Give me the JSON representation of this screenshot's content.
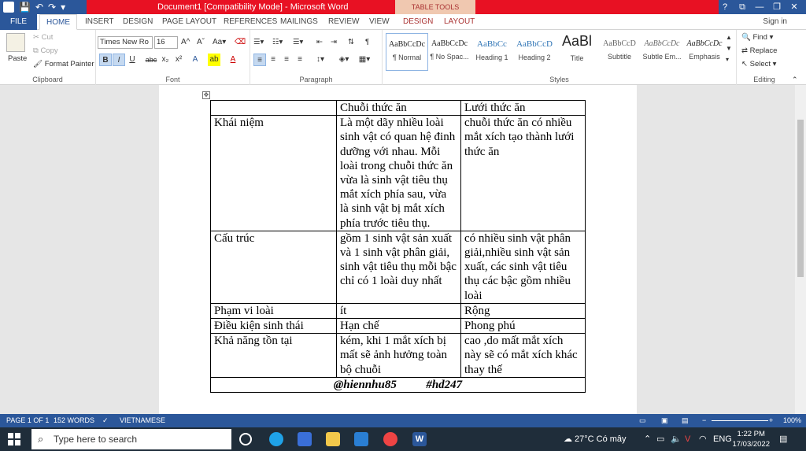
{
  "window": {
    "title": "Document1 [Compatibility Mode] -  Microsoft Word",
    "context_tab_group": "TABLE TOOLS",
    "help": "?",
    "restore_ribbon": "⧉",
    "minimize": "—",
    "maximize": "❐",
    "close": "✕"
  },
  "ribbon_tabs": [
    "FILE",
    "HOME",
    "INSERT",
    "DESIGN",
    "PAGE LAYOUT",
    "REFERENCES",
    "MAILINGS",
    "REVIEW",
    "VIEW",
    "DESIGN",
    "LAYOUT"
  ],
  "sign_in": "Sign in",
  "clipboard": {
    "paste": "Paste",
    "cut": "Cut",
    "copy": "Copy",
    "format_painter": "Format Painter",
    "label": "Clipboard"
  },
  "font": {
    "family": "Times New Ro",
    "size": "16",
    "label": "Font",
    "bold": "B",
    "italic": "I",
    "underline": "U",
    "strike": "abc",
    "subscript": "x₂",
    "superscript": "x²"
  },
  "paragraph": {
    "label": "Paragraph"
  },
  "styles": {
    "label": "Styles",
    "items": [
      {
        "sample": "AaBbCcDc",
        "name": "¶ Normal"
      },
      {
        "sample": "AaBbCcDc",
        "name": "¶ No Spac..."
      },
      {
        "sample": "AaBbCc",
        "name": "Heading 1"
      },
      {
        "sample": "AaBbCcD",
        "name": "Heading 2"
      },
      {
        "sample": "AaBl",
        "name": "Title"
      },
      {
        "sample": "AaBbCcD",
        "name": "Subtitle"
      },
      {
        "sample": "AaBbCcDc",
        "name": "Subtle Em..."
      },
      {
        "sample": "AaBbCcDc",
        "name": "Emphasis"
      }
    ]
  },
  "editing": {
    "label": "Editing",
    "find": "Find",
    "replace": "Replace",
    "select": "Select"
  },
  "table": {
    "header": [
      "",
      "Chuỗi thức ăn",
      "Lưới thức ăn"
    ],
    "rows": [
      [
        "Khái niệm",
        "Là một dãy nhiều loài sinh vật có quan hệ đinh dưỡng với nhau. Mỗi loài trong chuỗi thức ăn vừa là sinh vật tiêu thụ mắt xích phía sau, vừa là sinh vật bị mắt xích phía trước tiêu thụ.",
        " chuỗi thức ăn có nhiều mắt xích tạo thành lưới thức ăn"
      ],
      [
        "Cấu trúc",
        "gồm 1 sinh vật sản xuất và 1 sinh vật phân giải, sinh vật tiêu thụ mỗi bậc chỉ có 1 loài duy nhất",
        "có nhiều sinh vật phân giải,nhiều sinh vật sản xuất, các sinh vật tiêu thụ các bậc gồm nhiều loài"
      ],
      [
        "Phạm vi loài",
        "ít",
        "Rộng"
      ],
      [
        "Điều kiện sinh thái",
        "Hạn chế",
        "Phong phú"
      ],
      [
        "Khả năng tồn tại",
        " kém, khi 1 mắt xích bị mất sẽ ảnh hưởng toàn bộ chuỗi",
        "cao ,do mất mắt xích này sẽ có mắt xích khác thay thế"
      ]
    ],
    "footer": "@hiennhu85          #hd247"
  },
  "status": {
    "page": "PAGE 1 OF 1",
    "words": "152 WORDS",
    "language": "VIETNAMESE",
    "zoom": "100%"
  },
  "taskbar": {
    "search_placeholder": "Type here to search",
    "weather": "27°C  Có mây",
    "lang": "ENG",
    "time": "1:22 PM",
    "date": "17/03/2022"
  }
}
